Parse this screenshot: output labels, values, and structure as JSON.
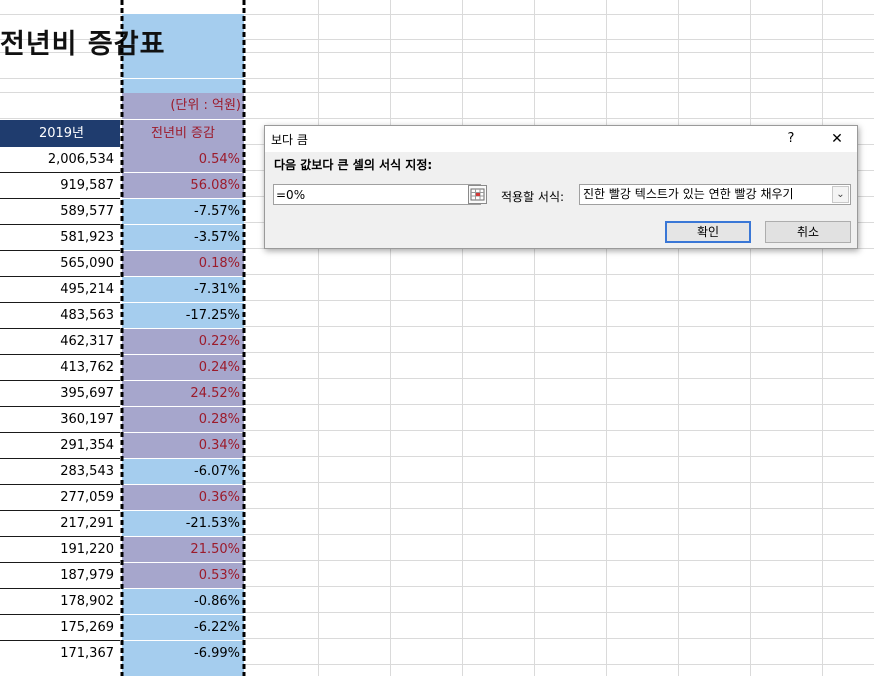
{
  "sheet": {
    "title": "전년비 증감표",
    "unit_label": "(단위 : 억원)",
    "header_year": "2019년",
    "header_change": "전년비 증감",
    "rows": [
      {
        "value": "2,006,534",
        "change": "0.54%",
        "sign": "pos"
      },
      {
        "value": "919,587",
        "change": "56.08%",
        "sign": "pos"
      },
      {
        "value": "589,577",
        "change": "-7.57%",
        "sign": "neg"
      },
      {
        "value": "581,923",
        "change": "-3.57%",
        "sign": "neg"
      },
      {
        "value": "565,090",
        "change": "0.18%",
        "sign": "pos"
      },
      {
        "value": "495,214",
        "change": "-7.31%",
        "sign": "neg"
      },
      {
        "value": "483,563",
        "change": "-17.25%",
        "sign": "neg"
      },
      {
        "value": "462,317",
        "change": "0.22%",
        "sign": "pos"
      },
      {
        "value": "413,762",
        "change": "0.24%",
        "sign": "pos"
      },
      {
        "value": "395,697",
        "change": "24.52%",
        "sign": "pos"
      },
      {
        "value": "360,197",
        "change": "0.28%",
        "sign": "pos"
      },
      {
        "value": "291,354",
        "change": "0.34%",
        "sign": "pos"
      },
      {
        "value": "283,543",
        "change": "-6.07%",
        "sign": "neg"
      },
      {
        "value": "277,059",
        "change": "0.36%",
        "sign": "pos"
      },
      {
        "value": "217,291",
        "change": "-21.53%",
        "sign": "neg"
      },
      {
        "value": "191,220",
        "change": "21.50%",
        "sign": "pos"
      },
      {
        "value": "187,979",
        "change": "0.53%",
        "sign": "pos"
      },
      {
        "value": "178,902",
        "change": "-0.86%",
        "sign": "neg"
      },
      {
        "value": "175,269",
        "change": "-6.22%",
        "sign": "neg"
      },
      {
        "value": "171,367",
        "change": "-6.99%",
        "sign": "neg"
      }
    ]
  },
  "colors": {
    "positive_fill": "#a6a6cc",
    "positive_text": "#9c1b2b",
    "negative_fill": "#a5cdee",
    "header_fill": "#1f3c6e"
  },
  "dialog": {
    "title": "보다 큼",
    "help": "?",
    "close": "✕",
    "instruction": "다음 값보다 큰 셀의 서식 지정:",
    "input_value": "=0%",
    "ref_icon": "range-select-icon",
    "apply_label": "적용할 서식:",
    "format_selected": "진한 빨강 텍스트가 있는 연한 빨강 채우기",
    "dropdown_icon": "chevron-down-icon",
    "ok": "확인",
    "cancel": "취소"
  }
}
